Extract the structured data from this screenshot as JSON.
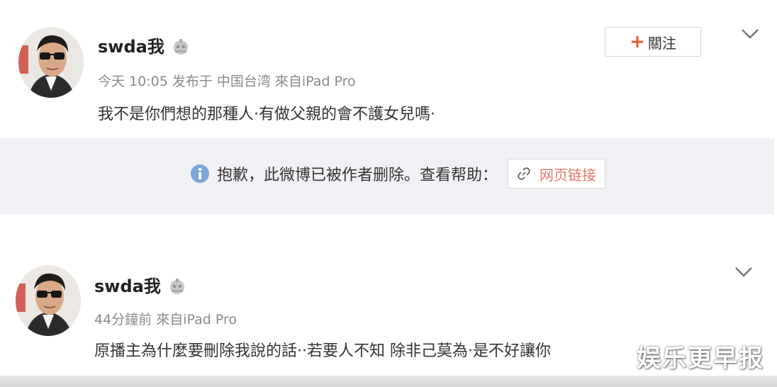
{
  "posts": [
    {
      "username": "swda我",
      "meta": "今天 10:05 发布于 中国台湾 來自iPad Pro",
      "content": "我不是你們想的那種人·有做父親的會不護女兒嗎·",
      "follow_label": "關注"
    },
    {
      "username": "swda我",
      "meta": "44分鐘前 來自iPad Pro",
      "content": "原播主為什麼要刪除我說的話··若要人不知 除非己莫為·是不好讓你"
    }
  ],
  "deleted_notice": {
    "text": "抱歉，此微博已被作者删除。查看帮助：",
    "link_label": "网页链接"
  },
  "watermark": "娱乐更早报",
  "colors": {
    "accent_orange": "#e25b2b",
    "link_red": "#e07a6a",
    "info_blue": "#7aa6d8",
    "muted_gray": "#8a8a8a",
    "panel_bg": "#f1f1f5"
  }
}
